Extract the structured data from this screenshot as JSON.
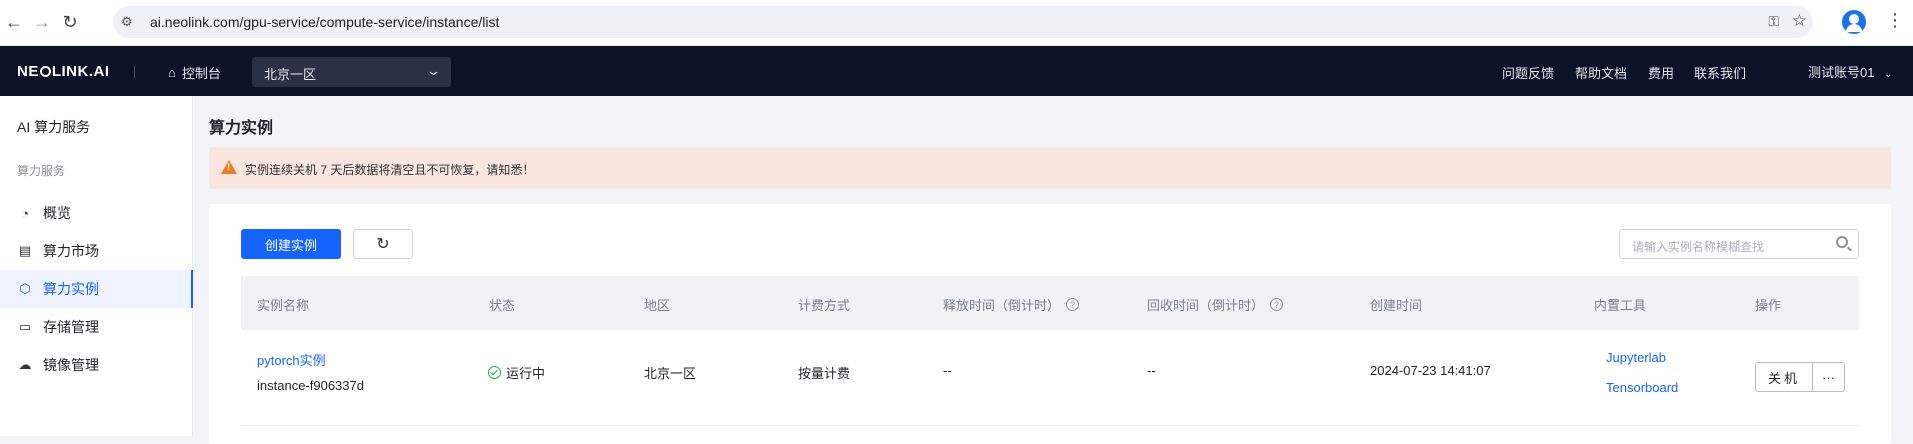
{
  "browser": {
    "url": "ai.neolink.com/gpu-service/compute-service/instance/list"
  },
  "header": {
    "logo": "NEOLINK.AI",
    "console_label": "控制台",
    "region_selected": "北京一区",
    "nav": [
      "问题反馈",
      "帮助文档",
      "费用",
      "联系我们"
    ],
    "account": "测试账号01"
  },
  "sidebar": {
    "title": "AI 算力服务",
    "group": "算力服务",
    "items": [
      {
        "label": "概览",
        "icon": "dashboard-icon"
      },
      {
        "label": "算力市场",
        "icon": "store-icon"
      },
      {
        "label": "算力实例",
        "icon": "instance-icon",
        "active": true
      },
      {
        "label": "存储管理",
        "icon": "storage-icon"
      },
      {
        "label": "镜像管理",
        "icon": "image-icon"
      }
    ]
  },
  "main": {
    "title": "算力实例",
    "alert": "实例连续关机 7 天后数据将清空且不可恢复，请知悉！",
    "create_button": "创建实例",
    "search_placeholder": "请输入实例名称模糊查找",
    "columns": [
      "实例名称",
      "状态",
      "地区",
      "计费方式",
      "释放时间（倒计时）",
      "回收时间（倒计时）",
      "创建时间",
      "内置工具",
      "操作"
    ],
    "rows": [
      {
        "name": "pytorch实例",
        "id": "instance-f906337d",
        "status": "运行中",
        "region": "北京一区",
        "billing": "按量计费",
        "release_time": "--",
        "recycle_time": "--",
        "created": "2024-07-23 14:41:07",
        "tools": [
          "Jupyterlab",
          "Tensorboard"
        ],
        "action_primary": "关机",
        "action_more": "···"
      }
    ]
  },
  "colors": {
    "primary": "#1664ff",
    "header_bg": "#0c1228",
    "alert_bg": "#f9e6e0",
    "warning": "#f2791c",
    "success": "#22a74a"
  }
}
